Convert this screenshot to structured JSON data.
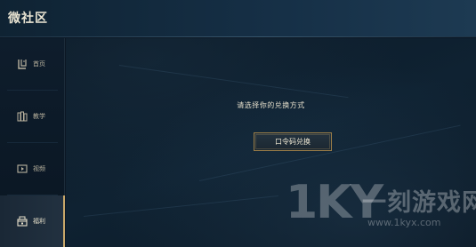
{
  "app": {
    "title": "微社区"
  },
  "sidebar": {
    "items": [
      {
        "label": "首页",
        "icon": "home-icon",
        "active": false
      },
      {
        "label": "教学",
        "icon": "book-icon",
        "active": false
      },
      {
        "label": "视频",
        "icon": "video-icon",
        "active": false
      },
      {
        "label": "福利",
        "icon": "gift-icon",
        "active": true
      }
    ]
  },
  "main": {
    "prompt": "请选择你的兑换方式",
    "redeem_button": "口令码兑换"
  },
  "watermark": {
    "logo": "1KY",
    "name": "一刻游戏网",
    "url": "www.1kyx.com"
  },
  "colors": {
    "accent": "#c8a769",
    "background": "#0b1724",
    "titlebar": "#163047"
  }
}
